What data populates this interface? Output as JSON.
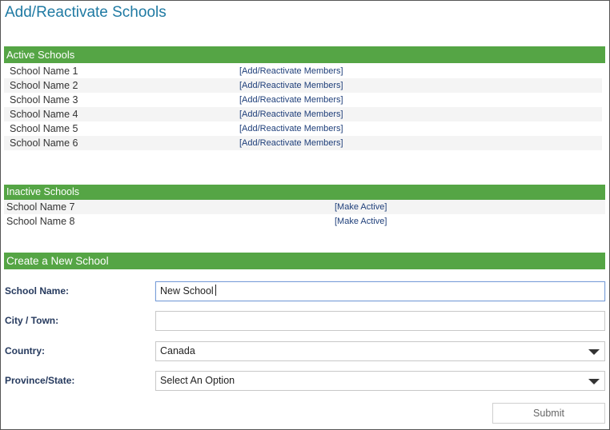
{
  "page": {
    "title": "Add/Reactivate Schools"
  },
  "active": {
    "header": "Active Schools",
    "rows": [
      {
        "name": "School Name 1",
        "action": "[Add/Reactivate Members]"
      },
      {
        "name": "School Name 2",
        "action": "[Add/Reactivate Members]"
      },
      {
        "name": "School Name 3",
        "action": "[Add/Reactivate Members]"
      },
      {
        "name": "School Name 4",
        "action": "[Add/Reactivate Members]"
      },
      {
        "name": "School Name 5",
        "action": "[Add/Reactivate Members]"
      },
      {
        "name": "School Name 6",
        "action": "[Add/Reactivate Members]"
      }
    ]
  },
  "inactive": {
    "header": "Inactive Schools",
    "rows": [
      {
        "name": "School Name 7",
        "action": "[Make Active]"
      },
      {
        "name": "School Name 8",
        "action": "[Make Active]"
      }
    ]
  },
  "create": {
    "header": "Create a New School",
    "school_name_label": "School Name:",
    "school_name_value": "New School",
    "city_label": "City / Town:",
    "city_value": "",
    "country_label": "Country:",
    "country_value": "Canada",
    "province_label": "Province/State:",
    "province_value": "Select An Option",
    "submit_label": "Submit"
  },
  "colors": {
    "accent": "#55a545",
    "title": "#1f7aa3"
  }
}
